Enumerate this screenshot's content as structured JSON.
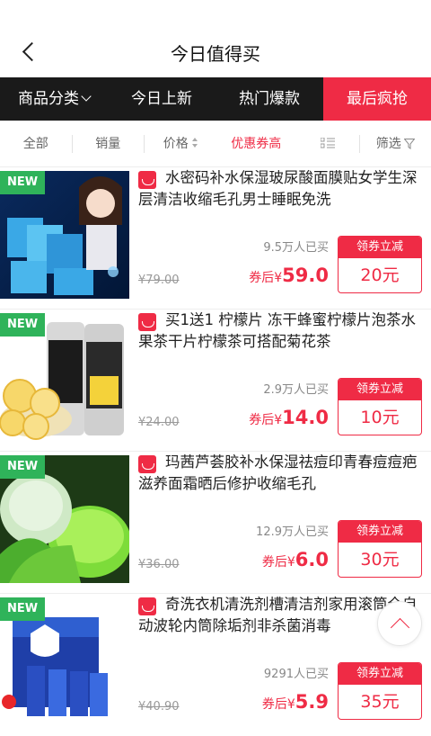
{
  "header": {
    "title": "今日值得买"
  },
  "tabs": [
    "商品分类",
    "今日上新",
    "热门爆款",
    "最后疯抢"
  ],
  "sort": {
    "all": "全部",
    "sales": "销量",
    "price": "价格",
    "coupon_high": "优惠券高",
    "filter": "筛选"
  },
  "items": [
    {
      "badge": "NEW",
      "name": "水密码补水保湿玻尿酸面膜贴女学生深层清洁收缩毛孔男士睡眠免洗",
      "sold": "9.5万人已买",
      "orig_price": "¥79.00",
      "after_label": "券后¥",
      "after_price": "59.0",
      "coupon_label": "领券立减",
      "coupon_value": "20元"
    },
    {
      "badge": "NEW",
      "name": "买1送1 柠檬片 冻干蜂蜜柠檬片泡茶水果茶干片柠檬茶可搭配菊花茶",
      "sold": "2.9万人已买",
      "orig_price": "¥24.00",
      "after_label": "券后¥",
      "after_price": "14.0",
      "coupon_label": "领券立减",
      "coupon_value": "10元"
    },
    {
      "badge": "NEW",
      "name": "玛茜芦荟胶补水保湿祛痘印青春痘痘疤滋养面霜晒后修护收缩毛孔",
      "sold": "12.9万人已买",
      "orig_price": "¥36.00",
      "after_label": "券后¥",
      "after_price": "6.0",
      "coupon_label": "领券立减",
      "coupon_value": "30元"
    },
    {
      "badge": "NEW",
      "name": "奇洗衣机清洗剂槽清洁剂家用滚筒全自动波轮内筒除垢剂非杀菌消毒",
      "sold": "9291人已买",
      "orig_price": "¥40.90",
      "after_label": "券后¥",
      "after_price": "5.9",
      "coupon_label": "领券立减",
      "coupon_value": "35元"
    }
  ],
  "colors": {
    "accent": "#ef2b45",
    "tabbar": "#1a1a1a",
    "new_badge": "#2fb35a"
  },
  "icons": {
    "back": "chevron-left-icon",
    "fab": "chevron-up-icon",
    "platform": "tmall-icon"
  }
}
